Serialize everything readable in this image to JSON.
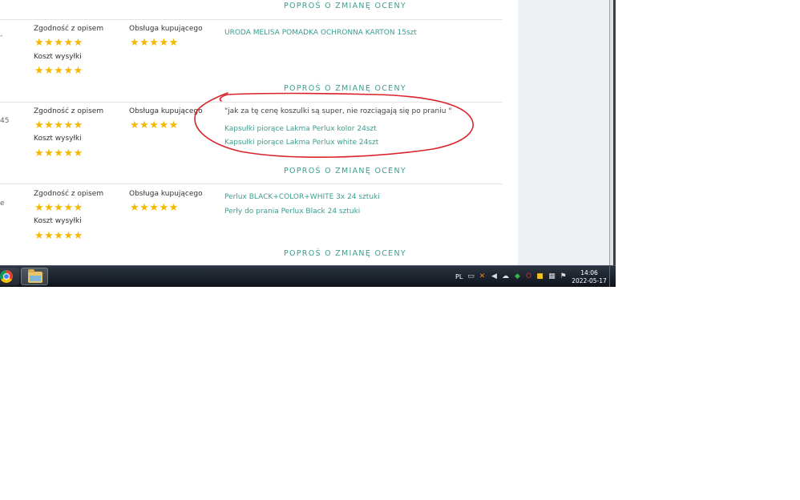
{
  "reviews": {
    "request_label": "POPROŚ O ZMIANĘ OCENY",
    "label_description": "Zgodność z opisem",
    "label_service": "Obsługa kupującego",
    "label_shipping": "Koszt wysyłki",
    "stars": "★★★★★",
    "rows": [
      {
        "edge": "",
        "quote": "",
        "products": [
          "URODA MELISA POMADKA OCHRONNA KARTON 15szt"
        ]
      },
      {
        "edge": "45",
        "quote": "\"jak za tę cenę koszulki są super, nie rozciągają się po praniu \"",
        "products": [
          "Kapsułki piorące Lakma Perlux kolor 24szt",
          "Kapsułki piorące Lakma Perlux white 24szt"
        ]
      },
      {
        "edge": "e",
        "quote": "",
        "products": [
          "Perlux BLACK+COLOR+WHITE 3x 24 sztuki",
          "Perły do prania Perlux Black 24 sztuki"
        ]
      }
    ]
  },
  "taskbar": {
    "language": "PL",
    "time": "14:06",
    "date": "2022-05-17",
    "tray_icons": [
      "keyboard-icon",
      "tools-icon",
      "volume-icon",
      "cloud-icon",
      "shield-icon",
      "opera-icon",
      "flag-icon",
      "network-icon",
      "notification-icon"
    ]
  },
  "colors": {
    "accent": "#3a9e8e",
    "star": "#f5b800",
    "annotation": "#d8232a"
  }
}
